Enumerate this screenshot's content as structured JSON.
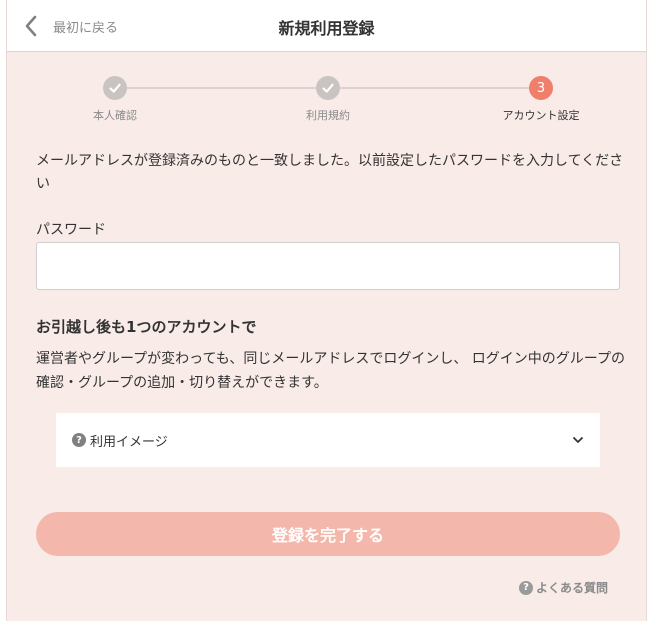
{
  "header": {
    "back_label": "最初に戻る",
    "title": "新規利用登録"
  },
  "steps": [
    {
      "label": "本人確認",
      "status": "done"
    },
    {
      "label": "利用規約",
      "status": "done"
    },
    {
      "label": "アカウント設定",
      "status": "active",
      "number": "3"
    }
  ],
  "message": "メールアドレスが登録済みのものと一致しました。以前設定したパスワードを入力してください",
  "password": {
    "label": "パスワード",
    "value": "",
    "placeholder": ""
  },
  "info": {
    "heading": "お引越し後も1つのアカウントで",
    "description": "運営者やグループが変わっても、同じメールアドレスでログインし、 ログイン中のグループの確認・グループの追加・切り替えができます。"
  },
  "accordion": {
    "label": "利用イメージ",
    "icon": "question-circle-icon"
  },
  "submit": {
    "label": "登録を完了する"
  },
  "faq": {
    "label": "よくある質問",
    "icon": "question-circle-icon"
  },
  "colors": {
    "background": "#f8ebe8",
    "accent": "#ef7f6a",
    "button_disabled": "#f4b7ab",
    "step_done": "#c9c4c2"
  }
}
